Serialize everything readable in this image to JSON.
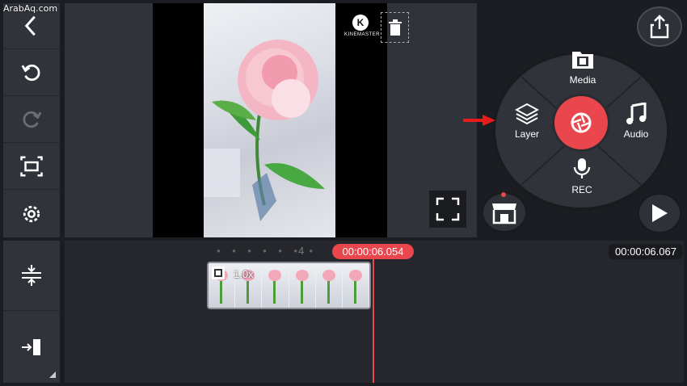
{
  "watermark": "ArabAq.com",
  "left_toolbar": {
    "items": [
      "back-icon",
      "undo-icon",
      "redo-icon",
      "crop-icon",
      "settings-icon"
    ]
  },
  "preview": {
    "logo_text": "KINEMASTER",
    "logo_letter": "K"
  },
  "menu": {
    "media": "Media",
    "layer": "Layer",
    "audio": "Audio",
    "rec": "REC"
  },
  "timeline": {
    "ruler_marker": "4",
    "current_time": "00:00:06.054",
    "total_time": "00:00:06.067",
    "clip_speed": "1.0x"
  },
  "colors": {
    "accent": "#e9464d",
    "panel": "#31333b",
    "background": "#1c1d22"
  }
}
